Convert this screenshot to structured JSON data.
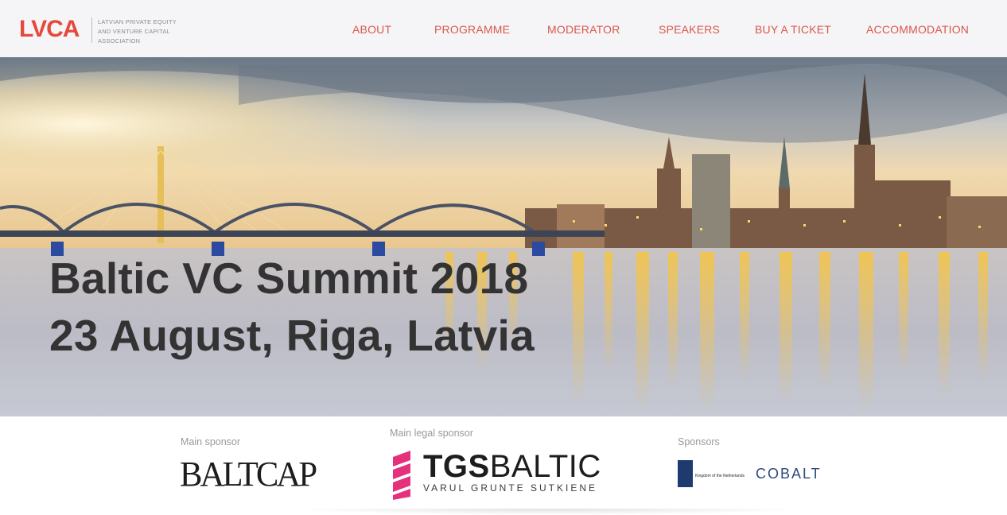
{
  "logo": {
    "mark": "LVCA",
    "line1": "Latvian Private Equity",
    "line2": "and Venture Capital",
    "line3": "Association"
  },
  "nav": {
    "items": [
      {
        "label": "ABOUT"
      },
      {
        "label": "PROGRAMME"
      },
      {
        "label": "MODERATOR"
      },
      {
        "label": "SPEAKERS"
      },
      {
        "label": "BUY A TICKET"
      },
      {
        "label": "ACCOMMODATION"
      }
    ]
  },
  "hero": {
    "title": "Baltic VC Summit 2018",
    "subtitle": "23 August, Riga, Latvia"
  },
  "sponsors": {
    "main": {
      "label": "Main sponsor",
      "logo_text": "BALTCAP"
    },
    "legal": {
      "label": "Main legal sponsor",
      "logo_main_bold": "TGS",
      "logo_main": "BALTIC",
      "logo_sub": "VARUL   GRUNTE   SUTKIENE"
    },
    "others": {
      "label": "Sponsors",
      "nl_text": "Kingdom of the Netherlands",
      "cobalt_text": "COBALT"
    }
  },
  "colors": {
    "accent": "#e4493b",
    "nav": "#d9574b",
    "title": "#333333"
  }
}
